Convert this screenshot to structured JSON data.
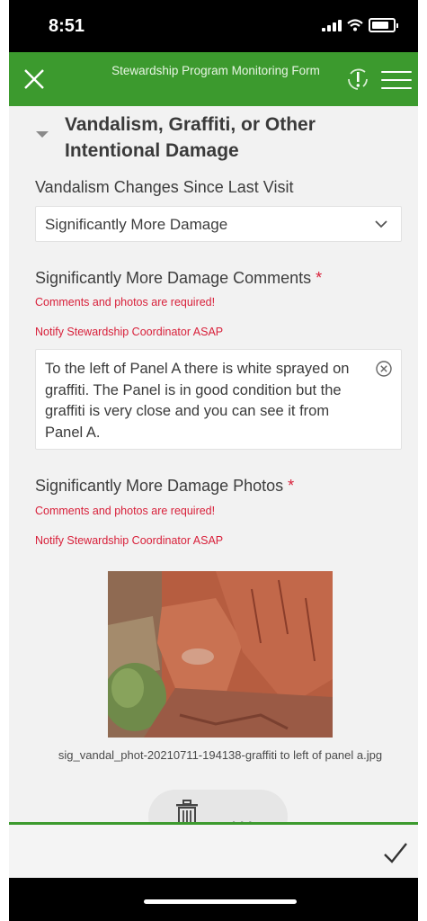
{
  "status_bar": {
    "time": "8:51"
  },
  "header": {
    "title": "Stewardship Program Monitoring Form"
  },
  "group": {
    "title": "Vandalism, Graffiti, or Other Intentional Damage"
  },
  "vandalism_changes": {
    "label": "Vandalism Changes Since Last Visit",
    "value": "Significantly More Damage"
  },
  "comments": {
    "label": "Significantly More Damage Comments",
    "required_mark": "*",
    "warning1": "Comments and photos are required!",
    "warning2": "Notify Stewardship Coordinator ASAP",
    "value": "To the left of Panel A there is white sprayed on graffiti. The Panel is in good condition but the graffiti is very close and you can see it from Panel A."
  },
  "photos": {
    "label": "Significantly More Damage Photos",
    "required_mark": "*",
    "warning1": "Comments and photos are required!",
    "warning2": "Notify Stewardship Coordinator ASAP",
    "filename": "sig_vandal_phot-20210711-194138-graffiti to left of panel a.jpg",
    "more_label": "..."
  },
  "colors": {
    "brand": "#3c9a2e",
    "required": "#d8203a"
  },
  "icons": {
    "close": "close-icon",
    "sync": "sync-alert-icon",
    "menu": "hamburger-menu-icon",
    "chevron": "chevron-down-icon",
    "clear": "clear-circle-icon",
    "trash": "trash-icon",
    "submit": "checkmark-icon"
  }
}
